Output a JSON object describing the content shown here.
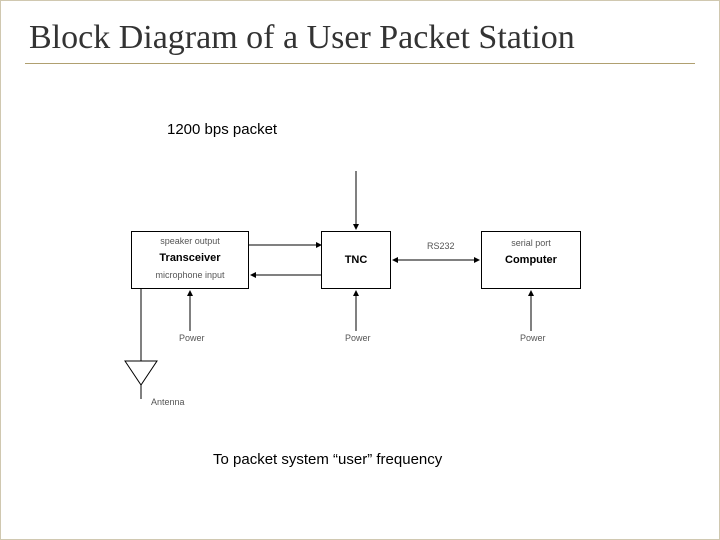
{
  "title": "Block Diagram of a User Packet Station",
  "annotations": {
    "top": "1200 bps packet",
    "bottom": "To packet system “user” frequency"
  },
  "blocks": {
    "transceiver": {
      "name": "Transceiver",
      "top_label": "speaker output",
      "bottom_label": "microphone input"
    },
    "tnc": {
      "name": "TNC"
    },
    "computer": {
      "name": "Computer",
      "top_label": "serial port"
    }
  },
  "labels": {
    "rs232": "RS232",
    "power": "Power",
    "antenna": "Antenna"
  }
}
